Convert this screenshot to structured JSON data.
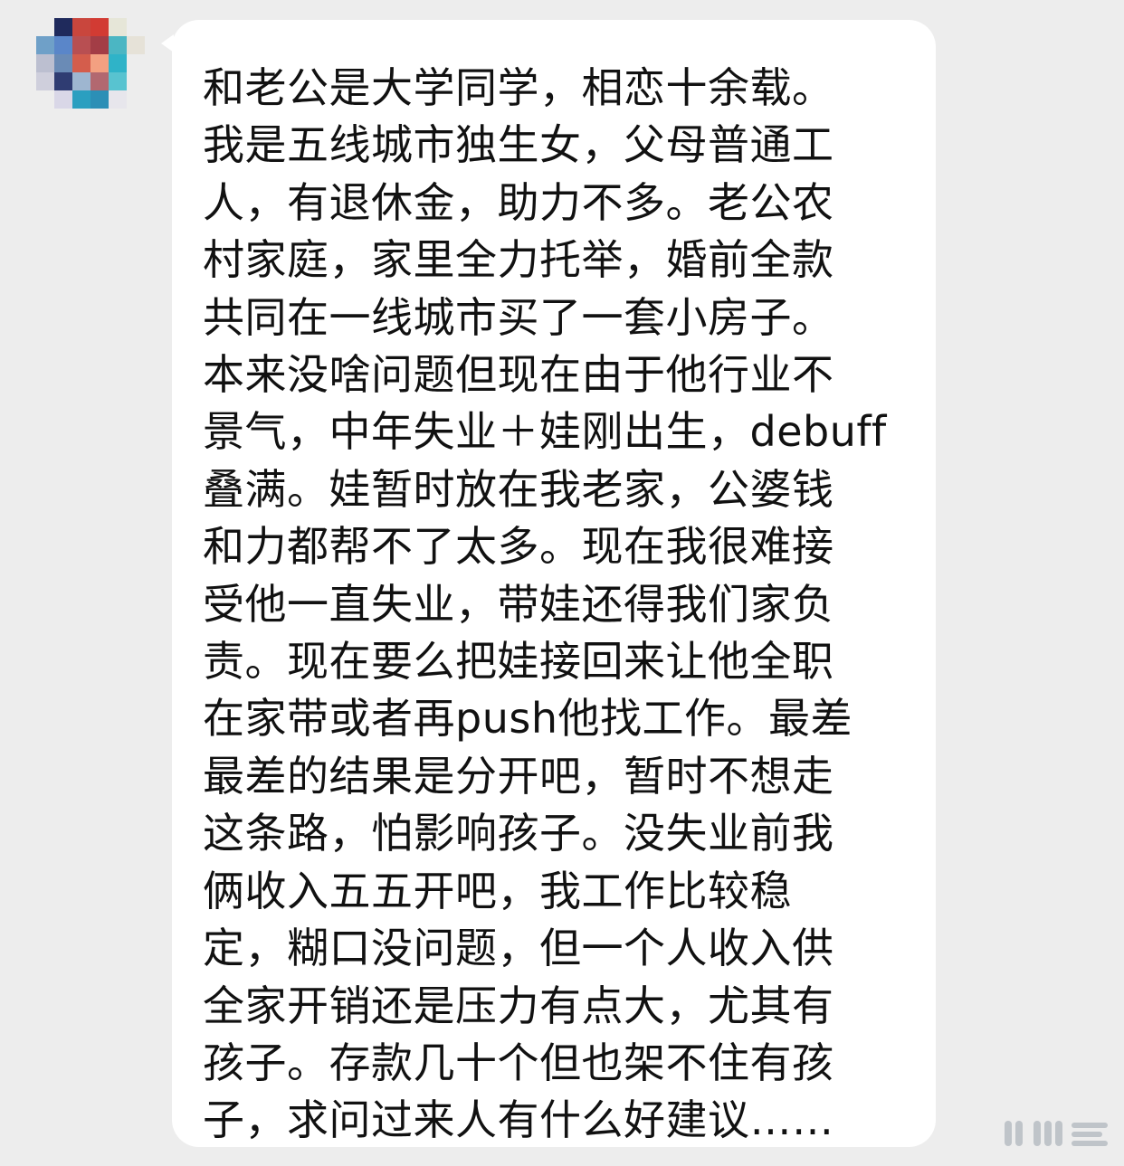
{
  "avatar": {
    "pixels": [
      [
        "#ededed",
        "#1f2a5c",
        "#c9463d",
        "#d23b33",
        "#e6e6d8",
        "#ededed"
      ],
      [
        "#6fa0c8",
        "#5a86c9",
        "#b84f52",
        "#a33d46",
        "#4bb6c3",
        "#e6e2d8"
      ],
      [
        "#bcbfd0",
        "#6a8bb6",
        "#d45d4c",
        "#f3a081",
        "#2fb3c8",
        "#ededed"
      ],
      [
        "#cfcfdc",
        "#2f3c72",
        "#9eb6d0",
        "#b26870",
        "#58c3d0",
        "#ededed"
      ],
      [
        "#ededed",
        "#d9d7e7",
        "#2b9fc0",
        "#2c8fb6",
        "#e7e6ec",
        "#ededed"
      ],
      [
        "#ededed",
        "#ededed",
        "#ededed",
        "#ededed",
        "#ededed",
        "#ededed"
      ]
    ]
  },
  "message": {
    "text": "和老公是大学同学，相恋十余载。\n我是五线城市独生女，父母普通工\n人，有退休金，助力不多。老公农\n村家庭，家里全力托举，婚前全款\n共同在一线城市买了一套小房子。\n本来没啥问题但现在由于他行业不\n景气，中年失业＋娃刚出生，debuff\n叠满。娃暂时放在我老家，公婆钱\n和力都帮不了太多。现在我很难接\n受他一直失业，带娃还得我们家负\n责。现在要么把娃接回来让他全职\n在家带或者再push他找工作。最差\n最差的结果是分开吧，暂时不想走\n这条路，怕影响孩子。没失业前我\n俩收入五五开吧，我工作比较稳\n定，糊口没问题，但一个人收入供\n全家开销还是压力有点大，尤其有\n孩子。存款几十个但也架不住有孩\n子，求问过来人有什么好建议……"
  },
  "colors": {
    "background": "#ededed",
    "bubble": "#ffffff",
    "text": "#111111"
  },
  "watermark": {
    "icon": "weibo-watermark-icon"
  }
}
